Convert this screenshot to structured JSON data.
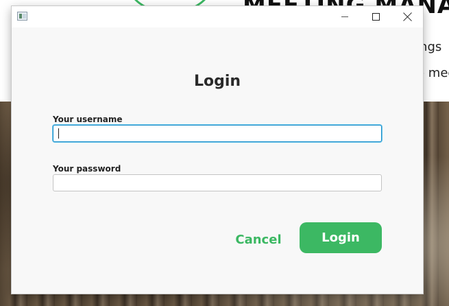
{
  "background": {
    "title": "MEETING MANAGER",
    "line1": "tings",
    "line2": "e mee"
  },
  "dialog": {
    "title_icon": "java-app-icon",
    "heading": "Login",
    "username_label": "Your username",
    "username_value": "",
    "password_label": "Your password",
    "password_value": "",
    "cancel_label": "Cancel",
    "login_label": "Login"
  },
  "colors": {
    "accent": "#3cb863",
    "focus_border": "#1a8fc9",
    "dialog_bg": "#f8f8f8"
  }
}
